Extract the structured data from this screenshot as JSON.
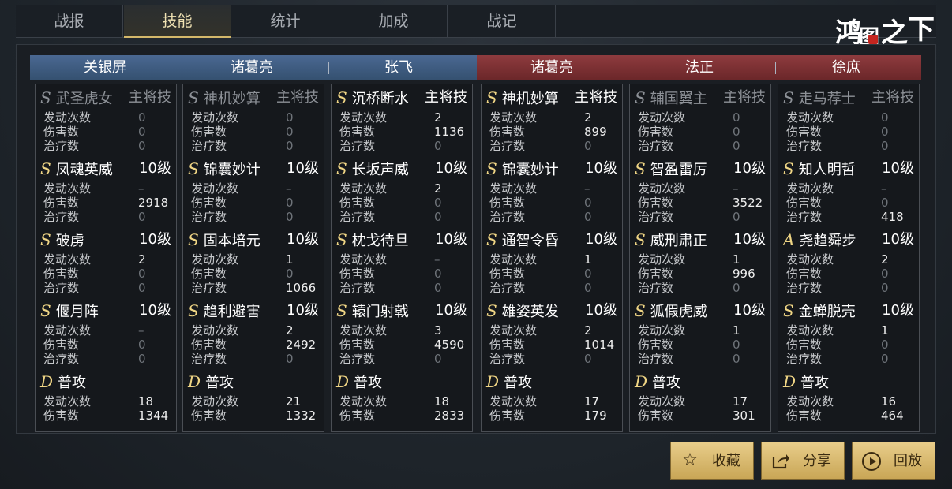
{
  "tabs": [
    "战报",
    "技能",
    "统计",
    "加成",
    "战记"
  ],
  "active_tab": 1,
  "logo_text": "鸿图之下",
  "teams": {
    "left": [
      "关银屏",
      "诸葛亮",
      "张飞"
    ],
    "right": [
      "诸葛亮",
      "法正",
      "徐庶"
    ]
  },
  "columns": [
    {
      "hero": "关银屏",
      "skills": [
        {
          "grade": "S",
          "name": "武圣虎女",
          "level": "主将技",
          "dim": true,
          "stats": [
            [
              "发动次数",
              "0"
            ],
            [
              "伤害数",
              "0"
            ],
            [
              "治疗数",
              "0"
            ]
          ]
        },
        {
          "grade": "S",
          "name": "凤魂英威",
          "level": "10级",
          "dim": false,
          "stats": [
            [
              "发动次数",
              "–"
            ],
            [
              "伤害数",
              "2918"
            ],
            [
              "治疗数",
              "0"
            ]
          ]
        },
        {
          "grade": "S",
          "name": "破虏",
          "level": "10级",
          "dim": false,
          "stats": [
            [
              "发动次数",
              "2"
            ],
            [
              "伤害数",
              "0"
            ],
            [
              "治疗数",
              "0"
            ]
          ]
        },
        {
          "grade": "S",
          "name": "偃月阵",
          "level": "10级",
          "dim": false,
          "stats": [
            [
              "发动次数",
              "–"
            ],
            [
              "伤害数",
              "0"
            ],
            [
              "治疗数",
              "0"
            ]
          ]
        },
        {
          "grade": "D",
          "name": "普攻",
          "level": "",
          "dim": false,
          "stats": [
            [
              "发动次数",
              "18"
            ],
            [
              "伤害数",
              "1344"
            ]
          ]
        }
      ]
    },
    {
      "hero": "诸葛亮",
      "skills": [
        {
          "grade": "S",
          "name": "神机妙算",
          "level": "主将技",
          "dim": true,
          "stats": [
            [
              "发动次数",
              "0"
            ],
            [
              "伤害数",
              "0"
            ],
            [
              "治疗数",
              "0"
            ]
          ]
        },
        {
          "grade": "S",
          "name": "锦囊妙计",
          "level": "10级",
          "dim": false,
          "stats": [
            [
              "发动次数",
              "–"
            ],
            [
              "伤害数",
              "0"
            ],
            [
              "治疗数",
              "0"
            ]
          ]
        },
        {
          "grade": "S",
          "name": "固本培元",
          "level": "10级",
          "dim": false,
          "stats": [
            [
              "发动次数",
              "1"
            ],
            [
              "伤害数",
              "0"
            ],
            [
              "治疗数",
              "1066"
            ]
          ]
        },
        {
          "grade": "S",
          "name": "趋利避害",
          "level": "10级",
          "dim": false,
          "stats": [
            [
              "发动次数",
              "2"
            ],
            [
              "伤害数",
              "2492"
            ],
            [
              "治疗数",
              "0"
            ]
          ]
        },
        {
          "grade": "D",
          "name": "普攻",
          "level": "",
          "dim": false,
          "stats": [
            [
              "发动次数",
              "21"
            ],
            [
              "伤害数",
              "1332"
            ]
          ]
        }
      ]
    },
    {
      "hero": "张飞",
      "skills": [
        {
          "grade": "S",
          "name": "沉桥断水",
          "level": "主将技",
          "dim": false,
          "stats": [
            [
              "发动次数",
              "2"
            ],
            [
              "伤害数",
              "1136"
            ],
            [
              "治疗数",
              "0"
            ]
          ]
        },
        {
          "grade": "S",
          "name": "长坂声威",
          "level": "10级",
          "dim": false,
          "stats": [
            [
              "发动次数",
              "2"
            ],
            [
              "伤害数",
              "0"
            ],
            [
              "治疗数",
              "0"
            ]
          ]
        },
        {
          "grade": "S",
          "name": "枕戈待旦",
          "level": "10级",
          "dim": false,
          "stats": [
            [
              "发动次数",
              "–"
            ],
            [
              "伤害数",
              "0"
            ],
            [
              "治疗数",
              "0"
            ]
          ]
        },
        {
          "grade": "S",
          "name": "辕门射戟",
          "level": "10级",
          "dim": false,
          "stats": [
            [
              "发动次数",
              "3"
            ],
            [
              "伤害数",
              "4590"
            ],
            [
              "治疗数",
              "0"
            ]
          ]
        },
        {
          "grade": "D",
          "name": "普攻",
          "level": "",
          "dim": false,
          "stats": [
            [
              "发动次数",
              "18"
            ],
            [
              "伤害数",
              "2833"
            ]
          ]
        }
      ]
    },
    {
      "hero": "诸葛亮",
      "skills": [
        {
          "grade": "S",
          "name": "神机妙算",
          "level": "主将技",
          "dim": false,
          "stats": [
            [
              "发动次数",
              "2"
            ],
            [
              "伤害数",
              "899"
            ],
            [
              "治疗数",
              "0"
            ]
          ]
        },
        {
          "grade": "S",
          "name": "锦囊妙计",
          "level": "10级",
          "dim": false,
          "stats": [
            [
              "发动次数",
              "–"
            ],
            [
              "伤害数",
              "0"
            ],
            [
              "治疗数",
              "0"
            ]
          ]
        },
        {
          "grade": "S",
          "name": "通智令昏",
          "level": "10级",
          "dim": false,
          "stats": [
            [
              "发动次数",
              "1"
            ],
            [
              "伤害数",
              "0"
            ],
            [
              "治疗数",
              "0"
            ]
          ]
        },
        {
          "grade": "S",
          "name": "雄姿英发",
          "level": "10级",
          "dim": false,
          "stats": [
            [
              "发动次数",
              "2"
            ],
            [
              "伤害数",
              "1014"
            ],
            [
              "治疗数",
              "0"
            ]
          ]
        },
        {
          "grade": "D",
          "name": "普攻",
          "level": "",
          "dim": false,
          "stats": [
            [
              "发动次数",
              "17"
            ],
            [
              "伤害数",
              "179"
            ]
          ]
        }
      ]
    },
    {
      "hero": "法正",
      "skills": [
        {
          "grade": "S",
          "name": "辅国翼主",
          "level": "主将技",
          "dim": true,
          "stats": [
            [
              "发动次数",
              "0"
            ],
            [
              "伤害数",
              "0"
            ],
            [
              "治疗数",
              "0"
            ]
          ]
        },
        {
          "grade": "S",
          "name": "智盈雷厉",
          "level": "10级",
          "dim": false,
          "stats": [
            [
              "发动次数",
              "–"
            ],
            [
              "伤害数",
              "3522"
            ],
            [
              "治疗数",
              "0"
            ]
          ]
        },
        {
          "grade": "S",
          "name": "威刑肃正",
          "level": "10级",
          "dim": false,
          "stats": [
            [
              "发动次数",
              "1"
            ],
            [
              "伤害数",
              "996"
            ],
            [
              "治疗数",
              "0"
            ]
          ]
        },
        {
          "grade": "S",
          "name": "狐假虎威",
          "level": "10级",
          "dim": false,
          "stats": [
            [
              "发动次数",
              "1"
            ],
            [
              "伤害数",
              "0"
            ],
            [
              "治疗数",
              "0"
            ]
          ]
        },
        {
          "grade": "D",
          "name": "普攻",
          "level": "",
          "dim": false,
          "stats": [
            [
              "发动次数",
              "17"
            ],
            [
              "伤害数",
              "301"
            ]
          ]
        }
      ]
    },
    {
      "hero": "徐庶",
      "skills": [
        {
          "grade": "S",
          "name": "走马荐士",
          "level": "主将技",
          "dim": true,
          "stats": [
            [
              "发动次数",
              "0"
            ],
            [
              "伤害数",
              "0"
            ],
            [
              "治疗数",
              "0"
            ]
          ]
        },
        {
          "grade": "S",
          "name": "知人明哲",
          "level": "10级",
          "dim": false,
          "stats": [
            [
              "发动次数",
              "–"
            ],
            [
              "伤害数",
              "0"
            ],
            [
              "治疗数",
              "418"
            ]
          ]
        },
        {
          "grade": "A",
          "name": "尧趋舜步",
          "level": "10级",
          "dim": false,
          "stats": [
            [
              "发动次数",
              "2"
            ],
            [
              "伤害数",
              "0"
            ],
            [
              "治疗数",
              "0"
            ]
          ]
        },
        {
          "grade": "S",
          "name": "金蝉脱壳",
          "level": "10级",
          "dim": false,
          "stats": [
            [
              "发动次数",
              "1"
            ],
            [
              "伤害数",
              "0"
            ],
            [
              "治疗数",
              "0"
            ]
          ]
        },
        {
          "grade": "D",
          "name": "普攻",
          "level": "",
          "dim": false,
          "stats": [
            [
              "发动次数",
              "16"
            ],
            [
              "伤害数",
              "464"
            ]
          ]
        }
      ]
    }
  ],
  "buttons": {
    "favorite": {
      "label": "收藏",
      "icon": "star-icon"
    },
    "share": {
      "label": "分享",
      "icon": "share-icon"
    },
    "replay": {
      "label": "回放",
      "icon": "play-icon"
    }
  }
}
